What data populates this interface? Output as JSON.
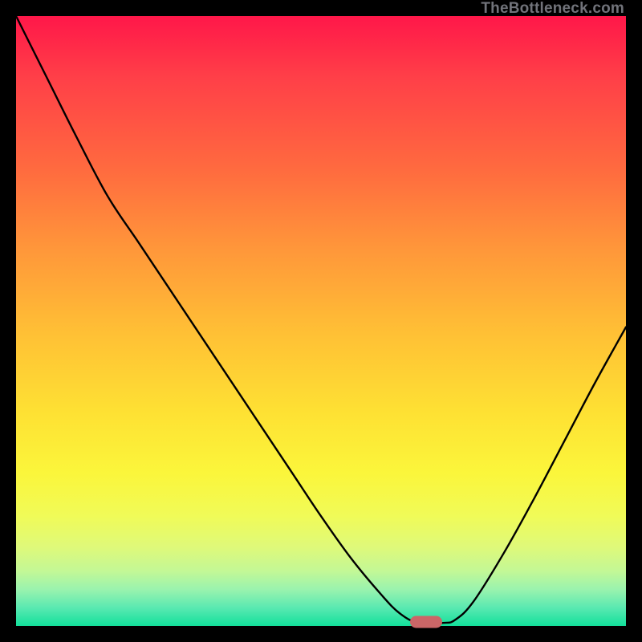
{
  "watermark": "TheBottleneck.com",
  "marker": {
    "x_frac": 0.672,
    "y_frac": 0.993,
    "color": "#cb6667"
  },
  "chart_data": {
    "type": "line",
    "title": "",
    "xlabel": "",
    "ylabel": "",
    "xlim": [
      0,
      1
    ],
    "ylim": [
      0,
      1
    ],
    "series": [
      {
        "name": "bottleneck-curve",
        "x": [
          0.0,
          0.05,
          0.1,
          0.15,
          0.2,
          0.25,
          0.3,
          0.35,
          0.4,
          0.45,
          0.5,
          0.55,
          0.6,
          0.63,
          0.66,
          0.7,
          0.72,
          0.75,
          0.8,
          0.85,
          0.9,
          0.95,
          1.0
        ],
        "y": [
          1.0,
          0.9,
          0.8,
          0.705,
          0.63,
          0.555,
          0.48,
          0.405,
          0.33,
          0.255,
          0.18,
          0.11,
          0.05,
          0.02,
          0.005,
          0.005,
          0.01,
          0.04,
          0.12,
          0.21,
          0.305,
          0.4,
          0.49
        ]
      }
    ],
    "gradient_stops": [
      {
        "pos": 0.0,
        "color": "#ff1749"
      },
      {
        "pos": 0.1,
        "color": "#ff3f48"
      },
      {
        "pos": 0.25,
        "color": "#ff6a3f"
      },
      {
        "pos": 0.38,
        "color": "#ff963a"
      },
      {
        "pos": 0.52,
        "color": "#ffc035"
      },
      {
        "pos": 0.65,
        "color": "#fee133"
      },
      {
        "pos": 0.75,
        "color": "#fbf63b"
      },
      {
        "pos": 0.82,
        "color": "#f0fb58"
      },
      {
        "pos": 0.87,
        "color": "#dff979"
      },
      {
        "pos": 0.91,
        "color": "#c3f896"
      },
      {
        "pos": 0.94,
        "color": "#9af3ae"
      },
      {
        "pos": 0.97,
        "color": "#5ae9b1"
      },
      {
        "pos": 1.0,
        "color": "#12e09b"
      }
    ]
  }
}
